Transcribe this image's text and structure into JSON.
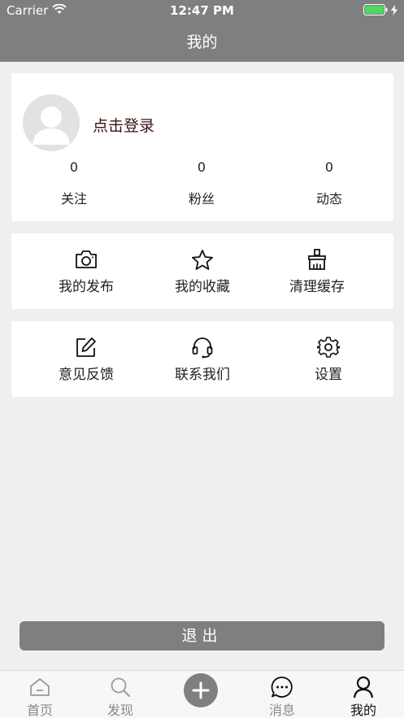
{
  "status_bar": {
    "carrier": "Carrier",
    "time": "12:47 PM"
  },
  "nav": {
    "title": "我的"
  },
  "profile": {
    "login_label": "点击登录",
    "stats": [
      {
        "value": "0",
        "label": "关注"
      },
      {
        "value": "0",
        "label": "粉丝"
      },
      {
        "value": "0",
        "label": "动态"
      }
    ]
  },
  "grid1": [
    {
      "label": "我的发布",
      "icon": "camera-icon"
    },
    {
      "label": "我的收藏",
      "icon": "star-icon"
    },
    {
      "label": "清理缓存",
      "icon": "broom-icon"
    }
  ],
  "grid2": [
    {
      "label": "意见反馈",
      "icon": "edit-icon"
    },
    {
      "label": "联系我们",
      "icon": "headset-icon"
    },
    {
      "label": "设置",
      "icon": "gear-icon"
    }
  ],
  "logout_label": "退出",
  "tabbar": {
    "items": [
      {
        "label": "首页",
        "icon": "home-icon"
      },
      {
        "label": "发现",
        "icon": "search-icon"
      },
      {
        "label": "",
        "icon": "plus-icon"
      },
      {
        "label": "消息",
        "icon": "message-icon"
      },
      {
        "label": "我的",
        "icon": "user-icon"
      }
    ],
    "active": "我的"
  },
  "colors": {
    "header": "#7f7f7f",
    "background": "#efefef",
    "login_text": "#3b1212",
    "battery": "#4cd964"
  }
}
